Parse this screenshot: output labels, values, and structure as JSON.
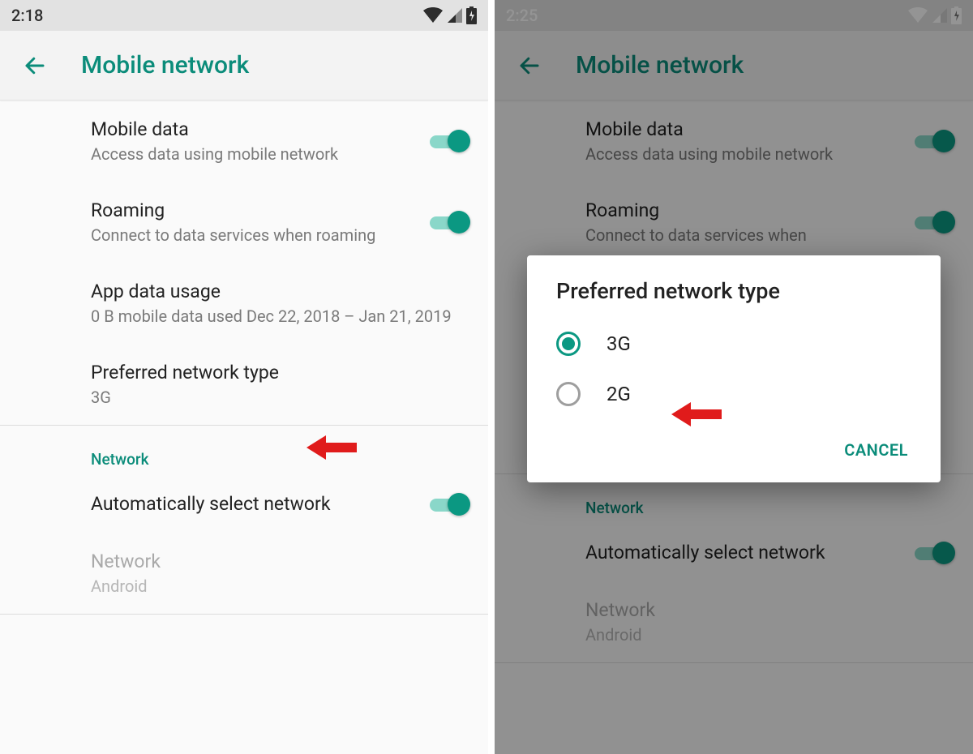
{
  "left": {
    "status_time": "2:18",
    "appbar_title": "Mobile network",
    "items": {
      "mobile_data": {
        "title": "Mobile data",
        "sub": "Access data using mobile network"
      },
      "roaming": {
        "title": "Roaming",
        "sub": "Connect to data services when roaming"
      },
      "app_usage": {
        "title": "App data usage",
        "sub": "0 B mobile data used Dec 22, 2018 – Jan 21, 2019"
      },
      "pref_net": {
        "title": "Preferred network type",
        "sub": "3G"
      },
      "section": "Network",
      "auto_select": {
        "title": "Automatically select network"
      },
      "network": {
        "title": "Network",
        "sub": "Android"
      }
    }
  },
  "right": {
    "status_time": "2:25",
    "appbar_title": "Mobile network",
    "items": {
      "mobile_data": {
        "title": "Mobile data",
        "sub": "Access data using mobile network"
      },
      "roaming": {
        "title": "Roaming",
        "sub": "Connect to data services when"
      },
      "section": "Network",
      "auto_select": {
        "title": "Automatically select network"
      },
      "network": {
        "title": "Network",
        "sub": "Android"
      }
    },
    "dialog": {
      "title": "Preferred network type",
      "option1": "3G",
      "option2": "2G",
      "cancel": "CANCEL"
    }
  }
}
